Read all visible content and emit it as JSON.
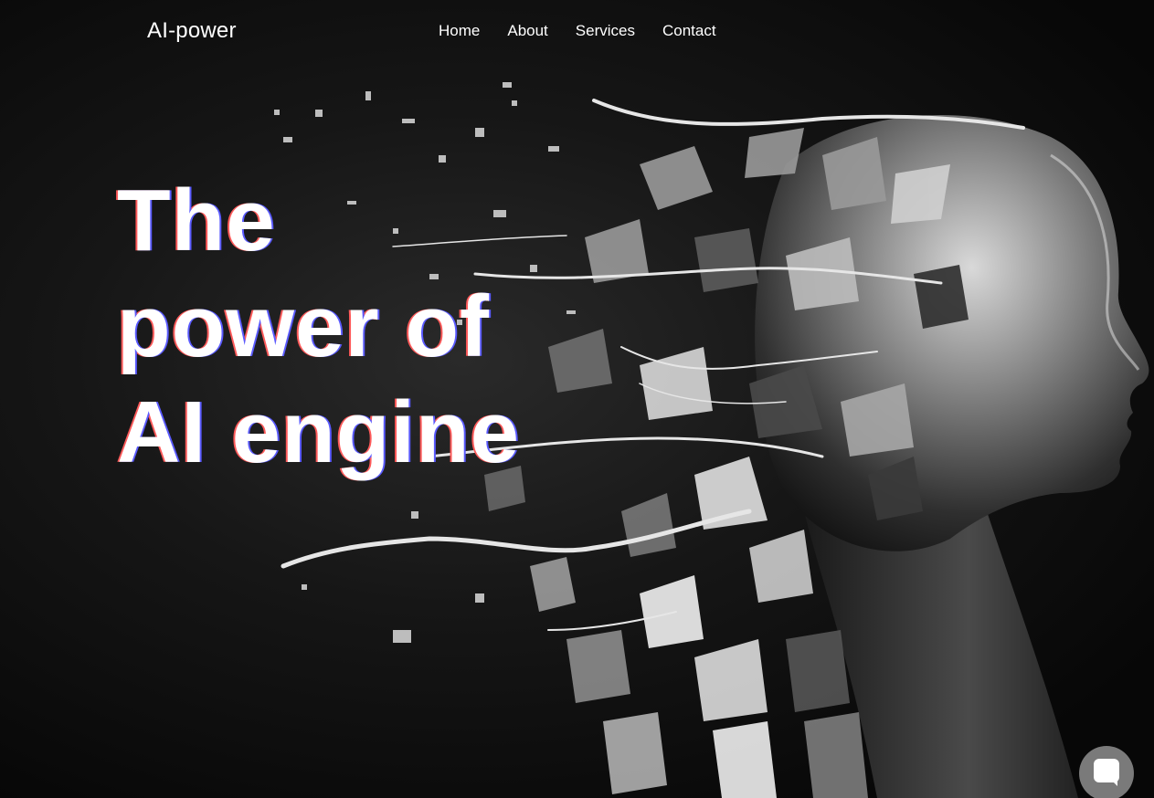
{
  "header": {
    "logo": "AI-power",
    "nav": [
      {
        "label": "Home"
      },
      {
        "label": "About"
      },
      {
        "label": "Services"
      },
      {
        "label": "Contact"
      }
    ]
  },
  "hero": {
    "headline_lines": [
      "The",
      "power of",
      "AI engine"
    ],
    "image": "ai-head-shattering-artwork"
  },
  "chat": {
    "icon": "chat-bubble-icon"
  },
  "colors": {
    "background": "#0b0b0b",
    "text": "#ffffff",
    "chat_button": "#7a7a7a"
  }
}
